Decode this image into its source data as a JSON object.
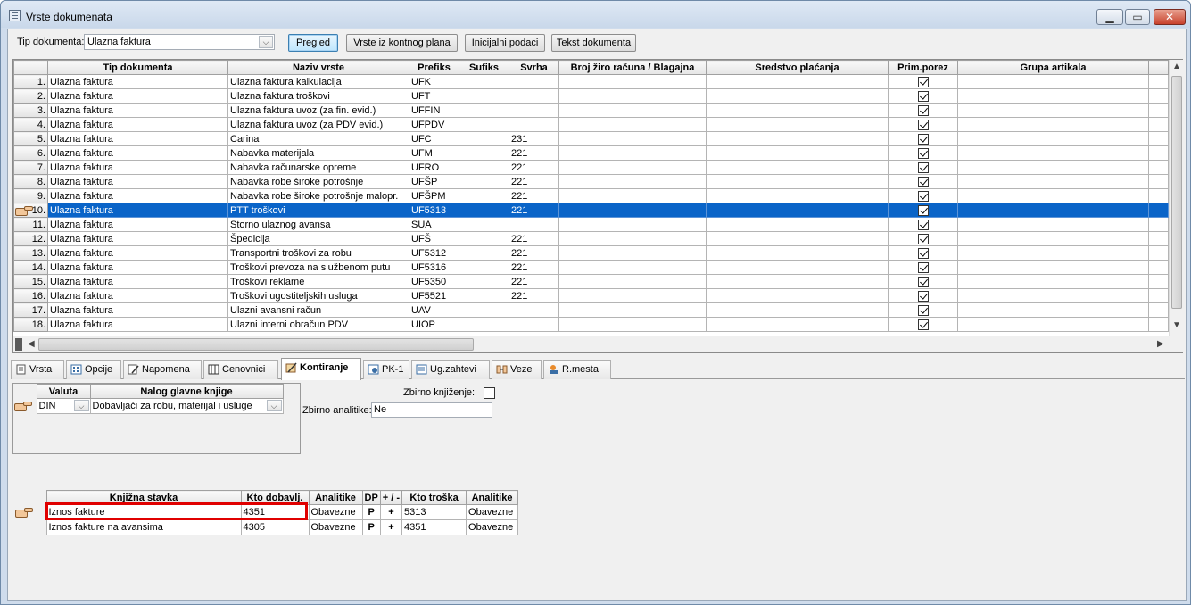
{
  "window": {
    "title": "Vrste dokumenata"
  },
  "toolbar": {
    "tip_label": "Tip dokumenta:",
    "tip_value": "Ulazna faktura",
    "buttons": [
      "Pregled",
      "Vrste iz kontnog plana",
      "Inicijalni podaci",
      "Tekst dokumenta"
    ]
  },
  "grid": {
    "columns": [
      "Tip dokumenta",
      "Naziv vrste",
      "Prefiks",
      "Sufiks",
      "Svrha",
      "Broj žiro računa / Blagajna",
      "Sredstvo plaćanja",
      "Prim.porez",
      "Grupa artikala"
    ],
    "selected_row": 10,
    "rows": [
      {
        "n": "1.",
        "tip": "Ulazna faktura",
        "naziv": " Ulazna faktura kalkulacija",
        "prefiks": "UFK",
        "sufiks": "",
        "svrha": "",
        "prim": true
      },
      {
        "n": "2.",
        "tip": "Ulazna faktura",
        "naziv": " Ulazna faktura troškovi",
        "prefiks": "UFT",
        "sufiks": "",
        "svrha": "",
        "prim": true
      },
      {
        "n": "3.",
        "tip": "Ulazna faktura",
        "naziv": " Ulazna faktura uvoz (za fin. evid.)",
        "prefiks": "UFFIN",
        "sufiks": "",
        "svrha": "",
        "prim": true
      },
      {
        "n": "4.",
        "tip": "Ulazna faktura",
        "naziv": " Ulazna faktura uvoz (za PDV evid.)",
        "prefiks": "UFPDV",
        "sufiks": "",
        "svrha": "",
        "prim": true
      },
      {
        "n": "5.",
        "tip": "Ulazna faktura",
        "naziv": "Carina",
        "prefiks": "UFC",
        "sufiks": "",
        "svrha": "231",
        "prim": true
      },
      {
        "n": "6.",
        "tip": "Ulazna faktura",
        "naziv": "Nabavka materijala",
        "prefiks": "UFM",
        "sufiks": "",
        "svrha": "221",
        "prim": true
      },
      {
        "n": "7.",
        "tip": "Ulazna faktura",
        "naziv": "Nabavka računarske opreme",
        "prefiks": "UFRO",
        "sufiks": "",
        "svrha": "221",
        "prim": true
      },
      {
        "n": "8.",
        "tip": "Ulazna faktura",
        "naziv": "Nabavka robe široke potrošnje",
        "prefiks": "UFŠP",
        "sufiks": "",
        "svrha": "221",
        "prim": true
      },
      {
        "n": "9.",
        "tip": "Ulazna faktura",
        "naziv": "Nabavka robe široke potrošnje malopr.",
        "prefiks": "UFŠPM",
        "sufiks": "",
        "svrha": "221",
        "prim": true
      },
      {
        "n": "10.",
        "tip": "Ulazna faktura",
        "naziv": "PTT troškovi",
        "prefiks": "UF5313",
        "sufiks": "",
        "svrha": "221",
        "prim": true
      },
      {
        "n": "11.",
        "tip": "Ulazna faktura",
        "naziv": "Storno ulaznog avansa",
        "prefiks": "SUA",
        "sufiks": "",
        "svrha": "",
        "prim": true
      },
      {
        "n": "12.",
        "tip": "Ulazna faktura",
        "naziv": "Špedicija",
        "prefiks": "UFŠ",
        "sufiks": "",
        "svrha": "221",
        "prim": true
      },
      {
        "n": "13.",
        "tip": "Ulazna faktura",
        "naziv": "Transportni troškovi za robu",
        "prefiks": "UF5312",
        "sufiks": "",
        "svrha": "221",
        "prim": true
      },
      {
        "n": "14.",
        "tip": "Ulazna faktura",
        "naziv": "Troškovi prevoza na službenom putu",
        "prefiks": "UF5316",
        "sufiks": "",
        "svrha": "221",
        "prim": true
      },
      {
        "n": "15.",
        "tip": "Ulazna faktura",
        "naziv": "Troškovi reklame",
        "prefiks": "UF5350",
        "sufiks": "",
        "svrha": "221",
        "prim": true
      },
      {
        "n": "16.",
        "tip": "Ulazna faktura",
        "naziv": "Troškovi ugostiteljskih usluga",
        "prefiks": "UF5521",
        "sufiks": "",
        "svrha": "221",
        "prim": true
      },
      {
        "n": "17.",
        "tip": "Ulazna faktura",
        "naziv": "Ulazni avansni račun",
        "prefiks": "UAV",
        "sufiks": "",
        "svrha": "",
        "prim": true
      },
      {
        "n": "18.",
        "tip": "Ulazna faktura",
        "naziv": "Ulazni interni obračun PDV",
        "prefiks": "UIOP",
        "sufiks": "",
        "svrha": "",
        "prim": true
      }
    ]
  },
  "tabs": [
    {
      "label": "Vrsta",
      "icon": "document-icon"
    },
    {
      "label": "Opcije",
      "icon": "options-grid-icon"
    },
    {
      "label": "Napomena",
      "icon": "note-icon"
    },
    {
      "label": "Cenovnici",
      "icon": "price-list-icon"
    },
    {
      "label": "Kontiranje",
      "icon": "accounting-icon",
      "active": true
    },
    {
      "label": "PK-1",
      "icon": "pk1-icon"
    },
    {
      "label": "Ug.zahtevi",
      "icon": "requirements-icon"
    },
    {
      "label": "Veze",
      "icon": "links-icon"
    },
    {
      "label": "R.mesta",
      "icon": "workplace-icon"
    }
  ],
  "kontiranje": {
    "valuta_grid": {
      "columns": [
        "Valuta",
        "Nalog glavne knjige"
      ],
      "row": {
        "valuta": "DIN",
        "nalog": "Dobavljači za robu, materijal i usluge"
      }
    },
    "zbirno_knjizenje_label": "Zbirno knjiženje:",
    "zbirno_knjizenje_checked": false,
    "zbirno_analitike_label": "Zbirno analitike:",
    "zbirno_analitike_value": "Ne",
    "stavke": {
      "columns": [
        "Knjižna stavka",
        "Kto dobavlj.",
        "Analitike",
        "DP",
        "+ / -",
        "Kto troška",
        "Analitike"
      ],
      "rows": [
        {
          "stavka": "Iznos fakture",
          "kto": "4351",
          "analitike": "Obavezne",
          "dp": "P",
          "sign": "+",
          "kto_troska": "5313",
          "analitike2": "Obavezne"
        },
        {
          "stavka": "Iznos fakture na avansima",
          "kto": "4305",
          "analitike": "Obavezne",
          "dp": "P",
          "sign": "+",
          "kto_troska": "4351",
          "analitike2": "Obavezne"
        }
      ]
    }
  }
}
